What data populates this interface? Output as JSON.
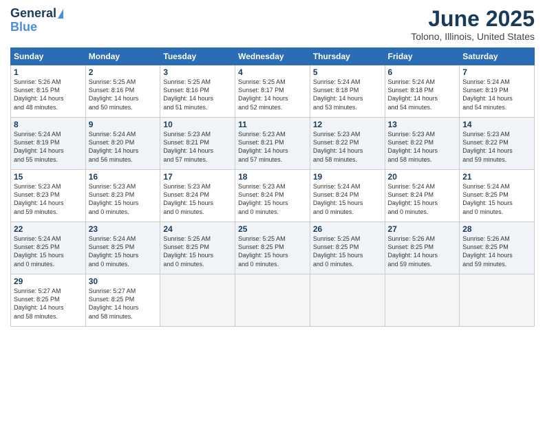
{
  "logo": {
    "line1": "General",
    "line2": "Blue"
  },
  "title": "June 2025",
  "subtitle": "Tolono, Illinois, United States",
  "days_of_week": [
    "Sunday",
    "Monday",
    "Tuesday",
    "Wednesday",
    "Thursday",
    "Friday",
    "Saturday"
  ],
  "weeks": [
    [
      {
        "num": "1",
        "info": "Sunrise: 5:26 AM\nSunset: 8:15 PM\nDaylight: 14 hours\nand 48 minutes."
      },
      {
        "num": "2",
        "info": "Sunrise: 5:25 AM\nSunset: 8:16 PM\nDaylight: 14 hours\nand 50 minutes."
      },
      {
        "num": "3",
        "info": "Sunrise: 5:25 AM\nSunset: 8:16 PM\nDaylight: 14 hours\nand 51 minutes."
      },
      {
        "num": "4",
        "info": "Sunrise: 5:25 AM\nSunset: 8:17 PM\nDaylight: 14 hours\nand 52 minutes."
      },
      {
        "num": "5",
        "info": "Sunrise: 5:24 AM\nSunset: 8:18 PM\nDaylight: 14 hours\nand 53 minutes."
      },
      {
        "num": "6",
        "info": "Sunrise: 5:24 AM\nSunset: 8:18 PM\nDaylight: 14 hours\nand 54 minutes."
      },
      {
        "num": "7",
        "info": "Sunrise: 5:24 AM\nSunset: 8:19 PM\nDaylight: 14 hours\nand 54 minutes."
      }
    ],
    [
      {
        "num": "8",
        "info": "Sunrise: 5:24 AM\nSunset: 8:19 PM\nDaylight: 14 hours\nand 55 minutes."
      },
      {
        "num": "9",
        "info": "Sunrise: 5:24 AM\nSunset: 8:20 PM\nDaylight: 14 hours\nand 56 minutes."
      },
      {
        "num": "10",
        "info": "Sunrise: 5:23 AM\nSunset: 8:21 PM\nDaylight: 14 hours\nand 57 minutes."
      },
      {
        "num": "11",
        "info": "Sunrise: 5:23 AM\nSunset: 8:21 PM\nDaylight: 14 hours\nand 57 minutes."
      },
      {
        "num": "12",
        "info": "Sunrise: 5:23 AM\nSunset: 8:22 PM\nDaylight: 14 hours\nand 58 minutes."
      },
      {
        "num": "13",
        "info": "Sunrise: 5:23 AM\nSunset: 8:22 PM\nDaylight: 14 hours\nand 58 minutes."
      },
      {
        "num": "14",
        "info": "Sunrise: 5:23 AM\nSunset: 8:22 PM\nDaylight: 14 hours\nand 59 minutes."
      }
    ],
    [
      {
        "num": "15",
        "info": "Sunrise: 5:23 AM\nSunset: 8:23 PM\nDaylight: 14 hours\nand 59 minutes."
      },
      {
        "num": "16",
        "info": "Sunrise: 5:23 AM\nSunset: 8:23 PM\nDaylight: 15 hours\nand 0 minutes."
      },
      {
        "num": "17",
        "info": "Sunrise: 5:23 AM\nSunset: 8:24 PM\nDaylight: 15 hours\nand 0 minutes."
      },
      {
        "num": "18",
        "info": "Sunrise: 5:23 AM\nSunset: 8:24 PM\nDaylight: 15 hours\nand 0 minutes."
      },
      {
        "num": "19",
        "info": "Sunrise: 5:24 AM\nSunset: 8:24 PM\nDaylight: 15 hours\nand 0 minutes."
      },
      {
        "num": "20",
        "info": "Sunrise: 5:24 AM\nSunset: 8:24 PM\nDaylight: 15 hours\nand 0 minutes."
      },
      {
        "num": "21",
        "info": "Sunrise: 5:24 AM\nSunset: 8:25 PM\nDaylight: 15 hours\nand 0 minutes."
      }
    ],
    [
      {
        "num": "22",
        "info": "Sunrise: 5:24 AM\nSunset: 8:25 PM\nDaylight: 15 hours\nand 0 minutes."
      },
      {
        "num": "23",
        "info": "Sunrise: 5:24 AM\nSunset: 8:25 PM\nDaylight: 15 hours\nand 0 minutes."
      },
      {
        "num": "24",
        "info": "Sunrise: 5:25 AM\nSunset: 8:25 PM\nDaylight: 15 hours\nand 0 minutes."
      },
      {
        "num": "25",
        "info": "Sunrise: 5:25 AM\nSunset: 8:25 PM\nDaylight: 15 hours\nand 0 minutes."
      },
      {
        "num": "26",
        "info": "Sunrise: 5:25 AM\nSunset: 8:25 PM\nDaylight: 15 hours\nand 0 minutes."
      },
      {
        "num": "27",
        "info": "Sunrise: 5:26 AM\nSunset: 8:25 PM\nDaylight: 14 hours\nand 59 minutes."
      },
      {
        "num": "28",
        "info": "Sunrise: 5:26 AM\nSunset: 8:25 PM\nDaylight: 14 hours\nand 59 minutes."
      }
    ],
    [
      {
        "num": "29",
        "info": "Sunrise: 5:27 AM\nSunset: 8:25 PM\nDaylight: 14 hours\nand 58 minutes."
      },
      {
        "num": "30",
        "info": "Sunrise: 5:27 AM\nSunset: 8:25 PM\nDaylight: 14 hours\nand 58 minutes."
      },
      {
        "num": "",
        "info": ""
      },
      {
        "num": "",
        "info": ""
      },
      {
        "num": "",
        "info": ""
      },
      {
        "num": "",
        "info": ""
      },
      {
        "num": "",
        "info": ""
      }
    ]
  ]
}
